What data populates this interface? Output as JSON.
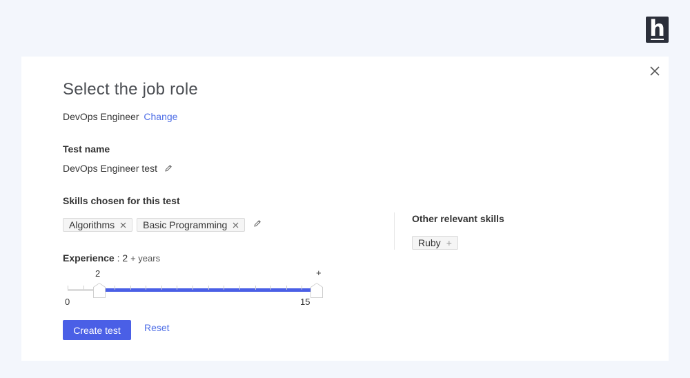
{
  "brand": {
    "logo_letter": "h"
  },
  "dialog": {
    "title": "Select the job role",
    "role": "DevOps Engineer",
    "change_label": "Change",
    "test_name_label": "Test name",
    "test_name_value": "DevOps Engineer test",
    "skills_label": "Skills chosen for this test",
    "skills": [
      "Algorithms",
      "Basic Programming"
    ],
    "experience_label": "Experience",
    "experience_value": "2",
    "experience_suffix": "+ years",
    "slider": {
      "min_label": "0",
      "max_label": "15",
      "low_value_label": "2",
      "high_value_label": "+",
      "min": 0,
      "max": 15,
      "low": 2,
      "high": 15
    },
    "create_button_label": "Create test",
    "reset_label": "Reset",
    "other_skills_label": "Other relevant skills",
    "other_skills": [
      "Ruby"
    ]
  },
  "colors": {
    "accent": "#4a5fe6",
    "link": "#4e6ee6",
    "background": "#f3f6fc"
  },
  "icons": {
    "close": "close-icon",
    "edit": "pencil-icon",
    "remove": "close-small-icon",
    "add": "plus-icon"
  }
}
